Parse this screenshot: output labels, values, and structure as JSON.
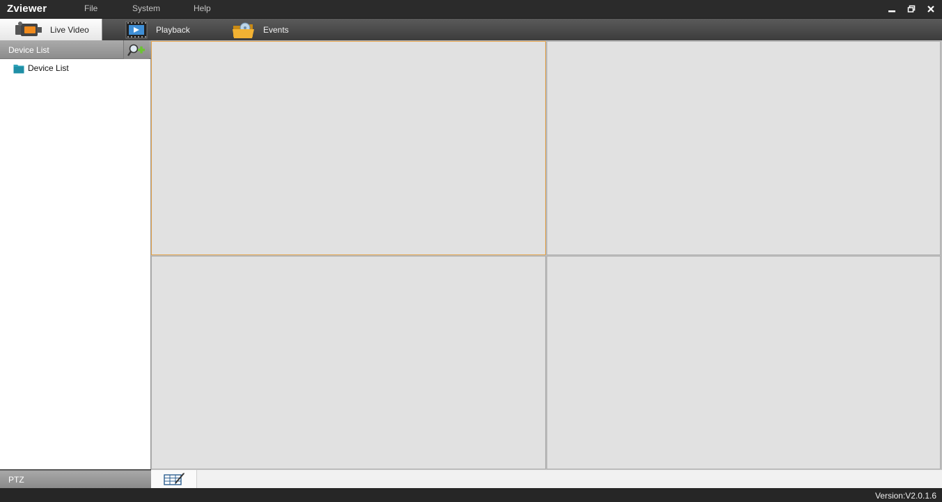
{
  "app": {
    "title": "Zviewer"
  },
  "menu": {
    "file": "File",
    "system": "System",
    "help": "Help"
  },
  "window_controls": {
    "minimize_icon": "minimize-icon",
    "restore_icon": "restore-icon",
    "close_icon": "close-icon"
  },
  "tabs": [
    {
      "label": "Live Video",
      "icon": "video-camera-icon",
      "active": true
    },
    {
      "label": "Playback",
      "icon": "film-strip-icon",
      "active": false
    },
    {
      "label": "Events",
      "icon": "event-folder-icon",
      "active": false
    }
  ],
  "sidebar": {
    "header": "Device List",
    "add_icon": "add-device-icon",
    "tree": [
      {
        "label": "Device List",
        "icon": "folder-icon"
      }
    ],
    "ptz_label": "PTZ"
  },
  "video_grid": {
    "cells": 4,
    "active_cell": 1,
    "active_border": "#e3a24a"
  },
  "toolbar": {
    "layout_icon": "layout-grid-icon"
  },
  "status": {
    "version": "Version:V2.0.1.6"
  },
  "colors": {
    "accent": "#e3a24a",
    "titlebar": "#2b2b2b",
    "cell_bg": "#e1e1e1"
  }
}
